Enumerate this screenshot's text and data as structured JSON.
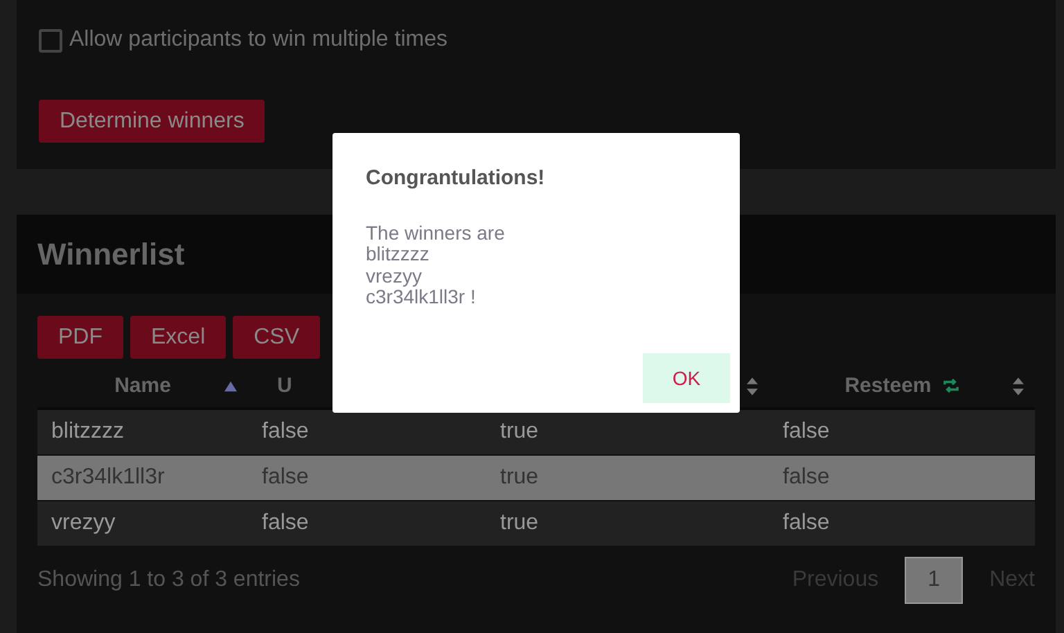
{
  "settings": {
    "allow_multiple": {
      "label": "Allow participants to win multiple times",
      "checked": false
    },
    "determine_button": "Determine winners"
  },
  "winnerlist": {
    "title": "Winnerlist",
    "export_buttons": [
      "PDF",
      "Excel",
      "CSV"
    ],
    "columns": [
      {
        "label": "Name",
        "kind": "plain",
        "sorted_ascending": true
      },
      {
        "label": "U",
        "kind": "plain"
      },
      {
        "kind": "plain",
        "sorted_ascending": false
      },
      {
        "label": "Resteem",
        "kind": "resteem",
        "sorted_ascending": false
      }
    ],
    "rows": [
      {
        "cells": [
          "blitzzzz",
          "false",
          "true",
          "false"
        ],
        "selected": false
      },
      {
        "cells": [
          "c3r34lk1ll3r",
          "false",
          "true",
          "false"
        ],
        "selected": true
      },
      {
        "cells": [
          "vrezyy",
          "false",
          "true",
          "false"
        ],
        "selected": false
      }
    ],
    "info": "Showing 1 to 3 of 3 entries",
    "pagination": {
      "previous": "Previous",
      "pages": [
        {
          "label": "1",
          "selected": true
        }
      ],
      "next": "Next"
    }
  },
  "dialog": {
    "title": "Congrantulations!",
    "message_lines": [
      "The winners are",
      "blitzzzz",
      "vrezyy",
      "c3r34lk1ll3r !"
    ],
    "ok_button": "OK"
  }
}
